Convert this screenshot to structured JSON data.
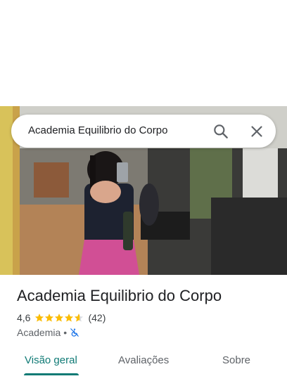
{
  "search": {
    "query": "Academia Equilibrio do Corpo"
  },
  "place": {
    "name": "Academia Equilibrio do Corpo",
    "rating": "4,6",
    "rating_value": 4.6,
    "review_count": "(42)",
    "category": "Academia",
    "separator": "•",
    "accessibility_icon": "no-wheelchair-icon"
  },
  "tabs": [
    {
      "label": "Visão geral",
      "active": true
    },
    {
      "label": "Avaliações",
      "active": false
    },
    {
      "label": "Sobre",
      "active": false
    }
  ],
  "colors": {
    "accent": "#0f7a75",
    "star": "#fbbc04",
    "accessibility_icon": "#1a73e8"
  }
}
